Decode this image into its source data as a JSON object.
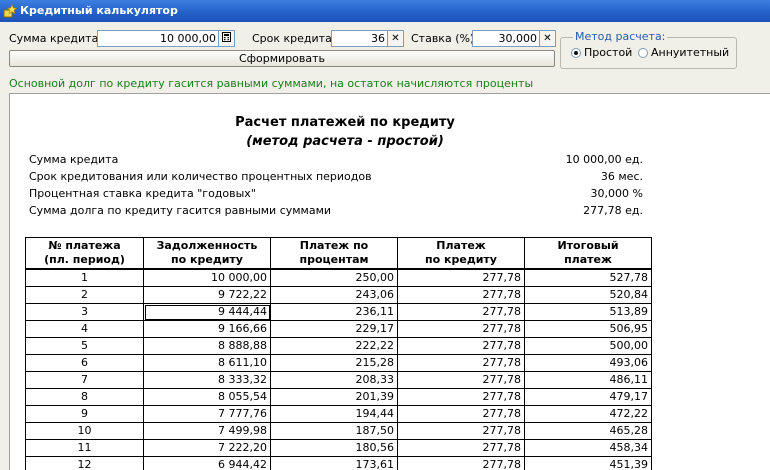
{
  "window": {
    "title": "Кредитный калькулятор"
  },
  "form": {
    "loan_amount_label": "Сумма кредита:",
    "loan_amount_value": "10 000,00",
    "term_label": "Срок кредита:",
    "term_value": "36",
    "rate_label": "Ставка (%):",
    "rate_value": "30,000",
    "generate_label": "Сформировать",
    "method_group_label": "Метод расчета:",
    "method_simple_label": "Простой",
    "method_annuity_label": "Аннуитетный",
    "method_selected": "simple",
    "hint": "Основной долг по кредиту гасится равными суммами, на остаток начисляются проценты"
  },
  "report": {
    "title": "Расчет платежей по кредиту",
    "subtitle": "(метод расчета - простой)",
    "summary": [
      {
        "key": "Сумма кредита",
        "value": "10 000,00 ед."
      },
      {
        "key": "Срок кредитования или количество процентных периодов",
        "value": "36 мес."
      },
      {
        "key": "Процентная ставка кредита \"годовых\"",
        "value": "30,000 %"
      },
      {
        "key": "Сумма долга по кредиту гасится равными суммами",
        "value": "277,78 ед."
      }
    ],
    "columns": [
      [
        "№ платежа",
        "(пл. период)"
      ],
      [
        "Задолженность",
        "по кредиту"
      ],
      [
        "Платеж по",
        "процентам"
      ],
      [
        "Платеж",
        "по кредиту"
      ],
      [
        "Итоговый",
        "платеж"
      ]
    ],
    "rows": [
      [
        "1",
        "10 000,00",
        "250,00",
        "277,78",
        "527,78"
      ],
      [
        "2",
        "9 722,22",
        "243,06",
        "277,78",
        "520,84"
      ],
      [
        "3",
        "9 444,44",
        "236,11",
        "277,78",
        "513,89"
      ],
      [
        "4",
        "9 166,66",
        "229,17",
        "277,78",
        "506,95"
      ],
      [
        "5",
        "8 888,88",
        "222,22",
        "277,78",
        "500,00"
      ],
      [
        "6",
        "8 611,10",
        "215,28",
        "277,78",
        "493,06"
      ],
      [
        "7",
        "8 333,32",
        "208,33",
        "277,78",
        "486,11"
      ],
      [
        "8",
        "8 055,54",
        "201,39",
        "277,78",
        "479,17"
      ],
      [
        "9",
        "7 777,76",
        "194,44",
        "277,78",
        "472,22"
      ],
      [
        "10",
        "7 499,98",
        "187,50",
        "277,78",
        "465,28"
      ],
      [
        "11",
        "7 222,20",
        "180,56",
        "277,78",
        "458,34"
      ],
      [
        "12",
        "6 944,42",
        "173,61",
        "277,78",
        "451,39"
      ]
    ]
  }
}
